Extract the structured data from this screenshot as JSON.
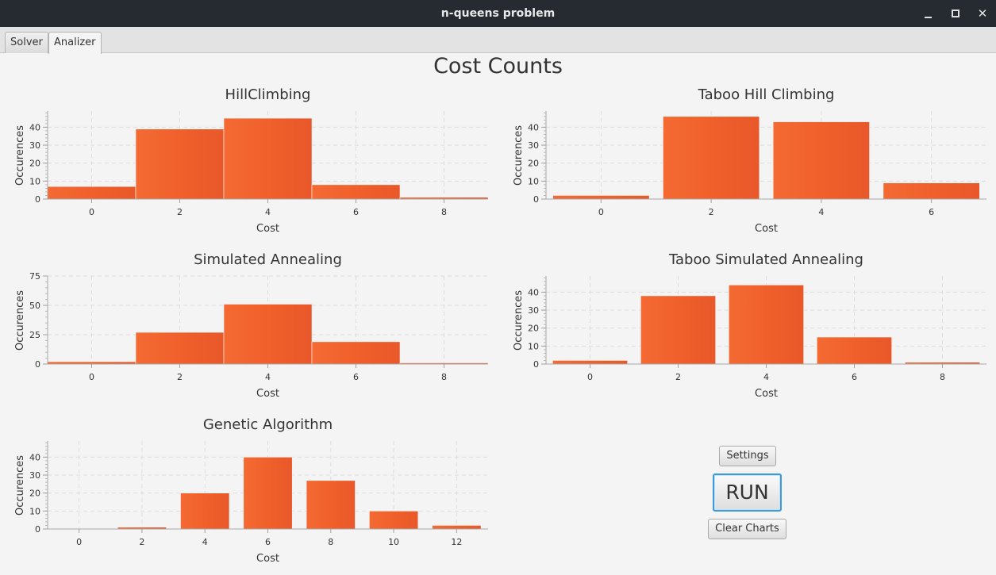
{
  "window": {
    "title": "n-queens problem"
  },
  "tabs": [
    {
      "label": "Solver",
      "active": false
    },
    {
      "label": "Analizer",
      "active": true
    }
  ],
  "page_title": "Cost Counts",
  "buttons": {
    "settings": "Settings",
    "run": "RUN",
    "clear": "Clear Charts"
  },
  "colors": {
    "bar": "#f0602b",
    "titlebar": "#252b30",
    "run_focus": "#3b9ad9"
  },
  "chart_data": [
    {
      "type": "bar",
      "title": "HillClimbing",
      "xlabel": "Cost",
      "ylabel": "Occurences",
      "x_ticks": [
        0,
        2,
        4,
        6,
        8
      ],
      "xlim": [
        -1,
        9
      ],
      "ylim": [
        0,
        49
      ],
      "y_ticks": [
        0,
        10,
        20,
        30,
        40
      ],
      "bar_width": 2,
      "bars": [
        {
          "x": 0,
          "y": 7
        },
        {
          "x": 2,
          "y": 39
        },
        {
          "x": 4,
          "y": 45
        },
        {
          "x": 6,
          "y": 8
        },
        {
          "x": 8,
          "y": 1
        }
      ],
      "grid": true
    },
    {
      "type": "bar",
      "title": "Taboo Hill Climbing",
      "xlabel": "Cost",
      "ylabel": "Occurences",
      "x_ticks": [
        0,
        2,
        4,
        6
      ],
      "xlim": [
        -1,
        7
      ],
      "ylim": [
        0,
        49
      ],
      "y_ticks": [
        0,
        10,
        20,
        30,
        40
      ],
      "bar_width": 1.75,
      "bars": [
        {
          "x": 0,
          "y": 2
        },
        {
          "x": 2,
          "y": 46
        },
        {
          "x": 4,
          "y": 43
        },
        {
          "x": 6,
          "y": 9
        }
      ],
      "grid": true
    },
    {
      "type": "bar",
      "title": "Simulated Annealing",
      "xlabel": "Cost",
      "ylabel": "Occurences",
      "x_ticks": [
        0,
        2,
        4,
        6,
        8
      ],
      "xlim": [
        -1,
        9
      ],
      "ylim": [
        0,
        75
      ],
      "y_ticks": [
        0,
        25,
        50,
        75
      ],
      "bar_width": 2,
      "bars": [
        {
          "x": 0,
          "y": 2
        },
        {
          "x": 2,
          "y": 27
        },
        {
          "x": 4,
          "y": 51
        },
        {
          "x": 6,
          "y": 19
        },
        {
          "x": 8,
          "y": 1
        }
      ],
      "grid": true
    },
    {
      "type": "bar",
      "title": "Taboo Simulated Annealing",
      "xlabel": "Cost",
      "ylabel": "Occurences",
      "x_ticks": [
        0,
        2,
        4,
        6,
        8
      ],
      "xlim": [
        -1,
        9
      ],
      "ylim": [
        0,
        49
      ],
      "y_ticks": [
        0,
        10,
        20,
        30,
        40
      ],
      "bar_width": 1.7,
      "bars": [
        {
          "x": 0,
          "y": 2
        },
        {
          "x": 2,
          "y": 38
        },
        {
          "x": 4,
          "y": 44
        },
        {
          "x": 6,
          "y": 15
        },
        {
          "x": 8,
          "y": 1
        }
      ],
      "grid": true
    },
    {
      "type": "bar",
      "title": "Genetic Algorithm",
      "xlabel": "Cost",
      "ylabel": "Occurences",
      "x_ticks": [
        0,
        2,
        4,
        6,
        8,
        10,
        12
      ],
      "xlim": [
        -1,
        13
      ],
      "ylim": [
        0,
        49
      ],
      "y_ticks": [
        0,
        10,
        20,
        30,
        40
      ],
      "bar_width": 1.55,
      "bars": [
        {
          "x": 2,
          "y": 1
        },
        {
          "x": 4,
          "y": 20
        },
        {
          "x": 6,
          "y": 40
        },
        {
          "x": 8,
          "y": 27
        },
        {
          "x": 10,
          "y": 10
        },
        {
          "x": 12,
          "y": 2
        }
      ],
      "grid": true
    }
  ]
}
